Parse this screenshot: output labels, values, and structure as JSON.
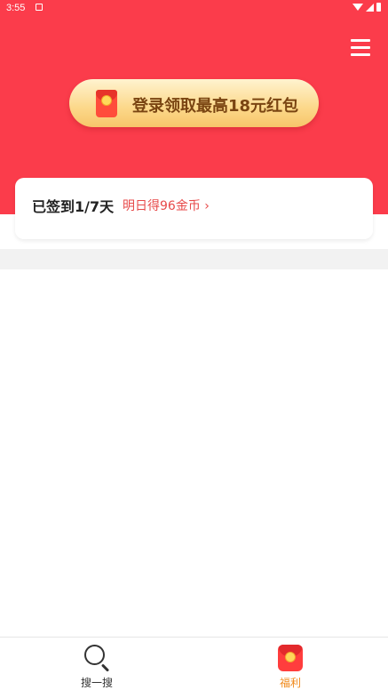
{
  "status_bar": {
    "time": "3:55"
  },
  "header": {
    "login_button": {
      "label": "登录领取最高18元红包"
    }
  },
  "signin": {
    "status": "已签到1/7天",
    "link": "明日得96金币 ›"
  },
  "bottom_nav": {
    "items": [
      {
        "label": "搜一搜",
        "icon": "search-icon",
        "active": false
      },
      {
        "label": "福利",
        "icon": "red-envelope-icon",
        "active": true
      }
    ]
  },
  "colors": {
    "header_red": "#fb3c4b",
    "button_gold": "#fcd88a",
    "button_text": "#7a4512",
    "link_red": "#e74a4a",
    "active_tab": "#f08a1c"
  }
}
